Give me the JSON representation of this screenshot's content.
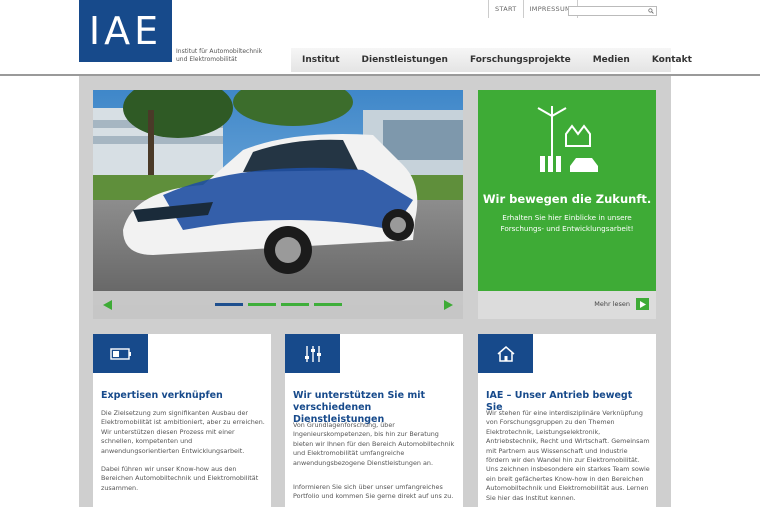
{
  "logo": {
    "text": "IAE",
    "tagline_line1": "Institut für Automobiltechnik",
    "tagline_line2": "und Elektromobilität"
  },
  "topnav": {
    "items": [
      "START",
      "IMPRESSUM"
    ]
  },
  "search": {
    "placeholder": ""
  },
  "mainnav": {
    "items": [
      "Institut",
      "Dienstleistungen",
      "Forschungsprojekte",
      "Medien",
      "Kontakt"
    ]
  },
  "slider": {
    "active_index": 0,
    "slide_count": 4
  },
  "teaser": {
    "title": "Wir bewegen die Zukunft.",
    "text": "Erhalten Sie hier Einblicke in unsere Forschungs- und Entwicklungsarbeit!",
    "more_label": "Mehr lesen"
  },
  "cards": [
    {
      "icon": "battery-icon",
      "title": "Expertisen verknüpfen",
      "p1": "Die Zielsetzung zum signifikanten Ausbau der Elektromobilität ist ambitioniert, aber zu erreichen. Wir unterstützen diesen Prozess mit einer schnellen, kompetenten und anwendungsorientierten Entwicklungsarbeit.",
      "p2": "Dabei führen wir unser Know-how aus den Bereichen Automobiltechnik und Elektromobilität zusammen."
    },
    {
      "icon": "sliders-icon",
      "title": "Wir unterstützen Sie mit verschiedenen Dienstleistungen",
      "p1": "Von Grundlagenforschung, über Ingenieurskompetenzen, bis hin zur Beratung bieten wir Ihnen für den Bereich Automobiltechnik und  Elektromobilität umfangreiche anwendungsbezogene Dienstleistungen an.",
      "p2": "Informieren Sie sich über unser umfangreiches Portfolio und kommen Sie gerne direkt auf uns zu."
    },
    {
      "icon": "home-icon",
      "title": "IAE – Unser Antrieb bewegt Sie",
      "p1": "Wir stehen für eine interdisziplinäre Verknüpfung von Forschungsgruppen zu den Themen Elektrotechnik, Leistungselektronik, Antriebstechnik, Recht und Wirtschaft. Gemeinsam mit Partnern aus Wissenschaft und Industrie fördern wir den Wandel hin zur Elektromobilität. Uns zeichnen insbesondere ein starkes Team sowie ein breit gefächertes Know-how in den Bereichen Automobiltechnik und Elektromobilität aus. Lernen Sie hier das Institut kennen.",
      "p2": ""
    }
  ],
  "colors": {
    "brand_blue": "#174a8b",
    "accent_green": "#3eab36",
    "background_gray": "#cfcfcf"
  }
}
